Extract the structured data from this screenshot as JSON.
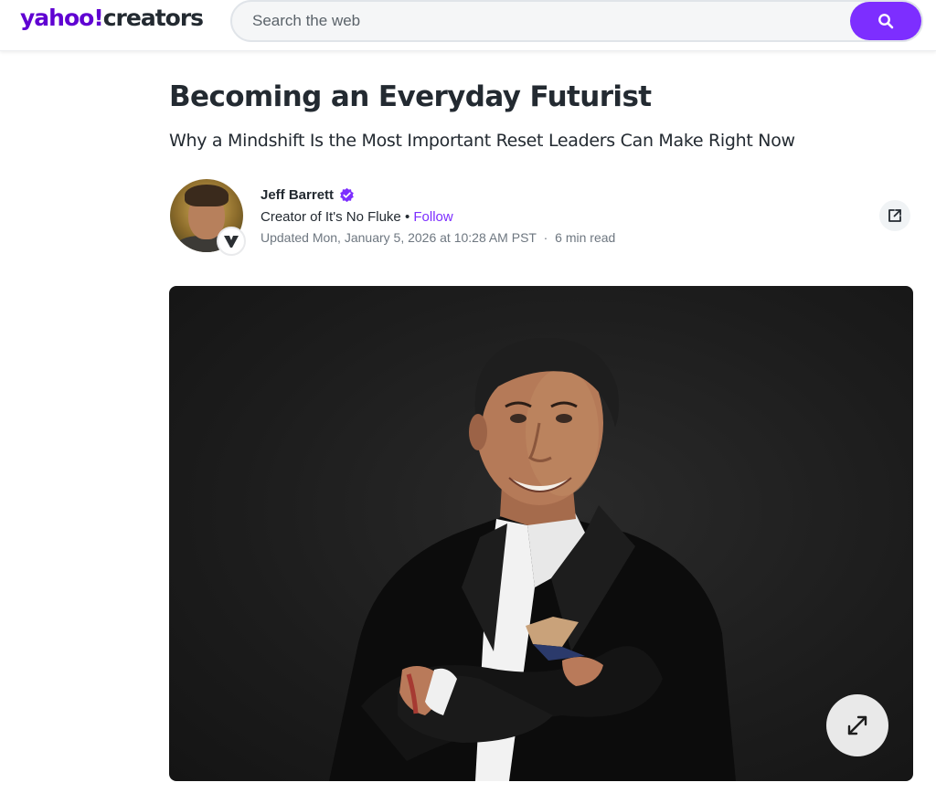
{
  "header": {
    "logo_main": "yahoo",
    "logo_bang": "!",
    "logo_section": "creators",
    "search_placeholder": "Search the web",
    "search_icon": "search-icon"
  },
  "article": {
    "title": "Becoming an Everyday Futurist",
    "subtitle": "Why a Mindshift Is the Most Important Reset Leaders Can Make Right Now",
    "author": {
      "name": "Jeff Barrett",
      "verified_icon": "verified-badge-icon",
      "creator_prefix": "Creator of",
      "publication": "It's No Fluke",
      "separator": "•",
      "follow_label": "Follow",
      "updated": "Updated Mon, January 5, 2026 at 10:28 AM PST",
      "dot": "·",
      "read_time": "6 min read"
    },
    "share_icon": "share-external-icon",
    "expand_icon": "expand-arrows-icon"
  },
  "colors": {
    "brand": "#6001d2",
    "accent": "#7d2eff",
    "text": "#232a31",
    "muted": "#6e7780"
  }
}
